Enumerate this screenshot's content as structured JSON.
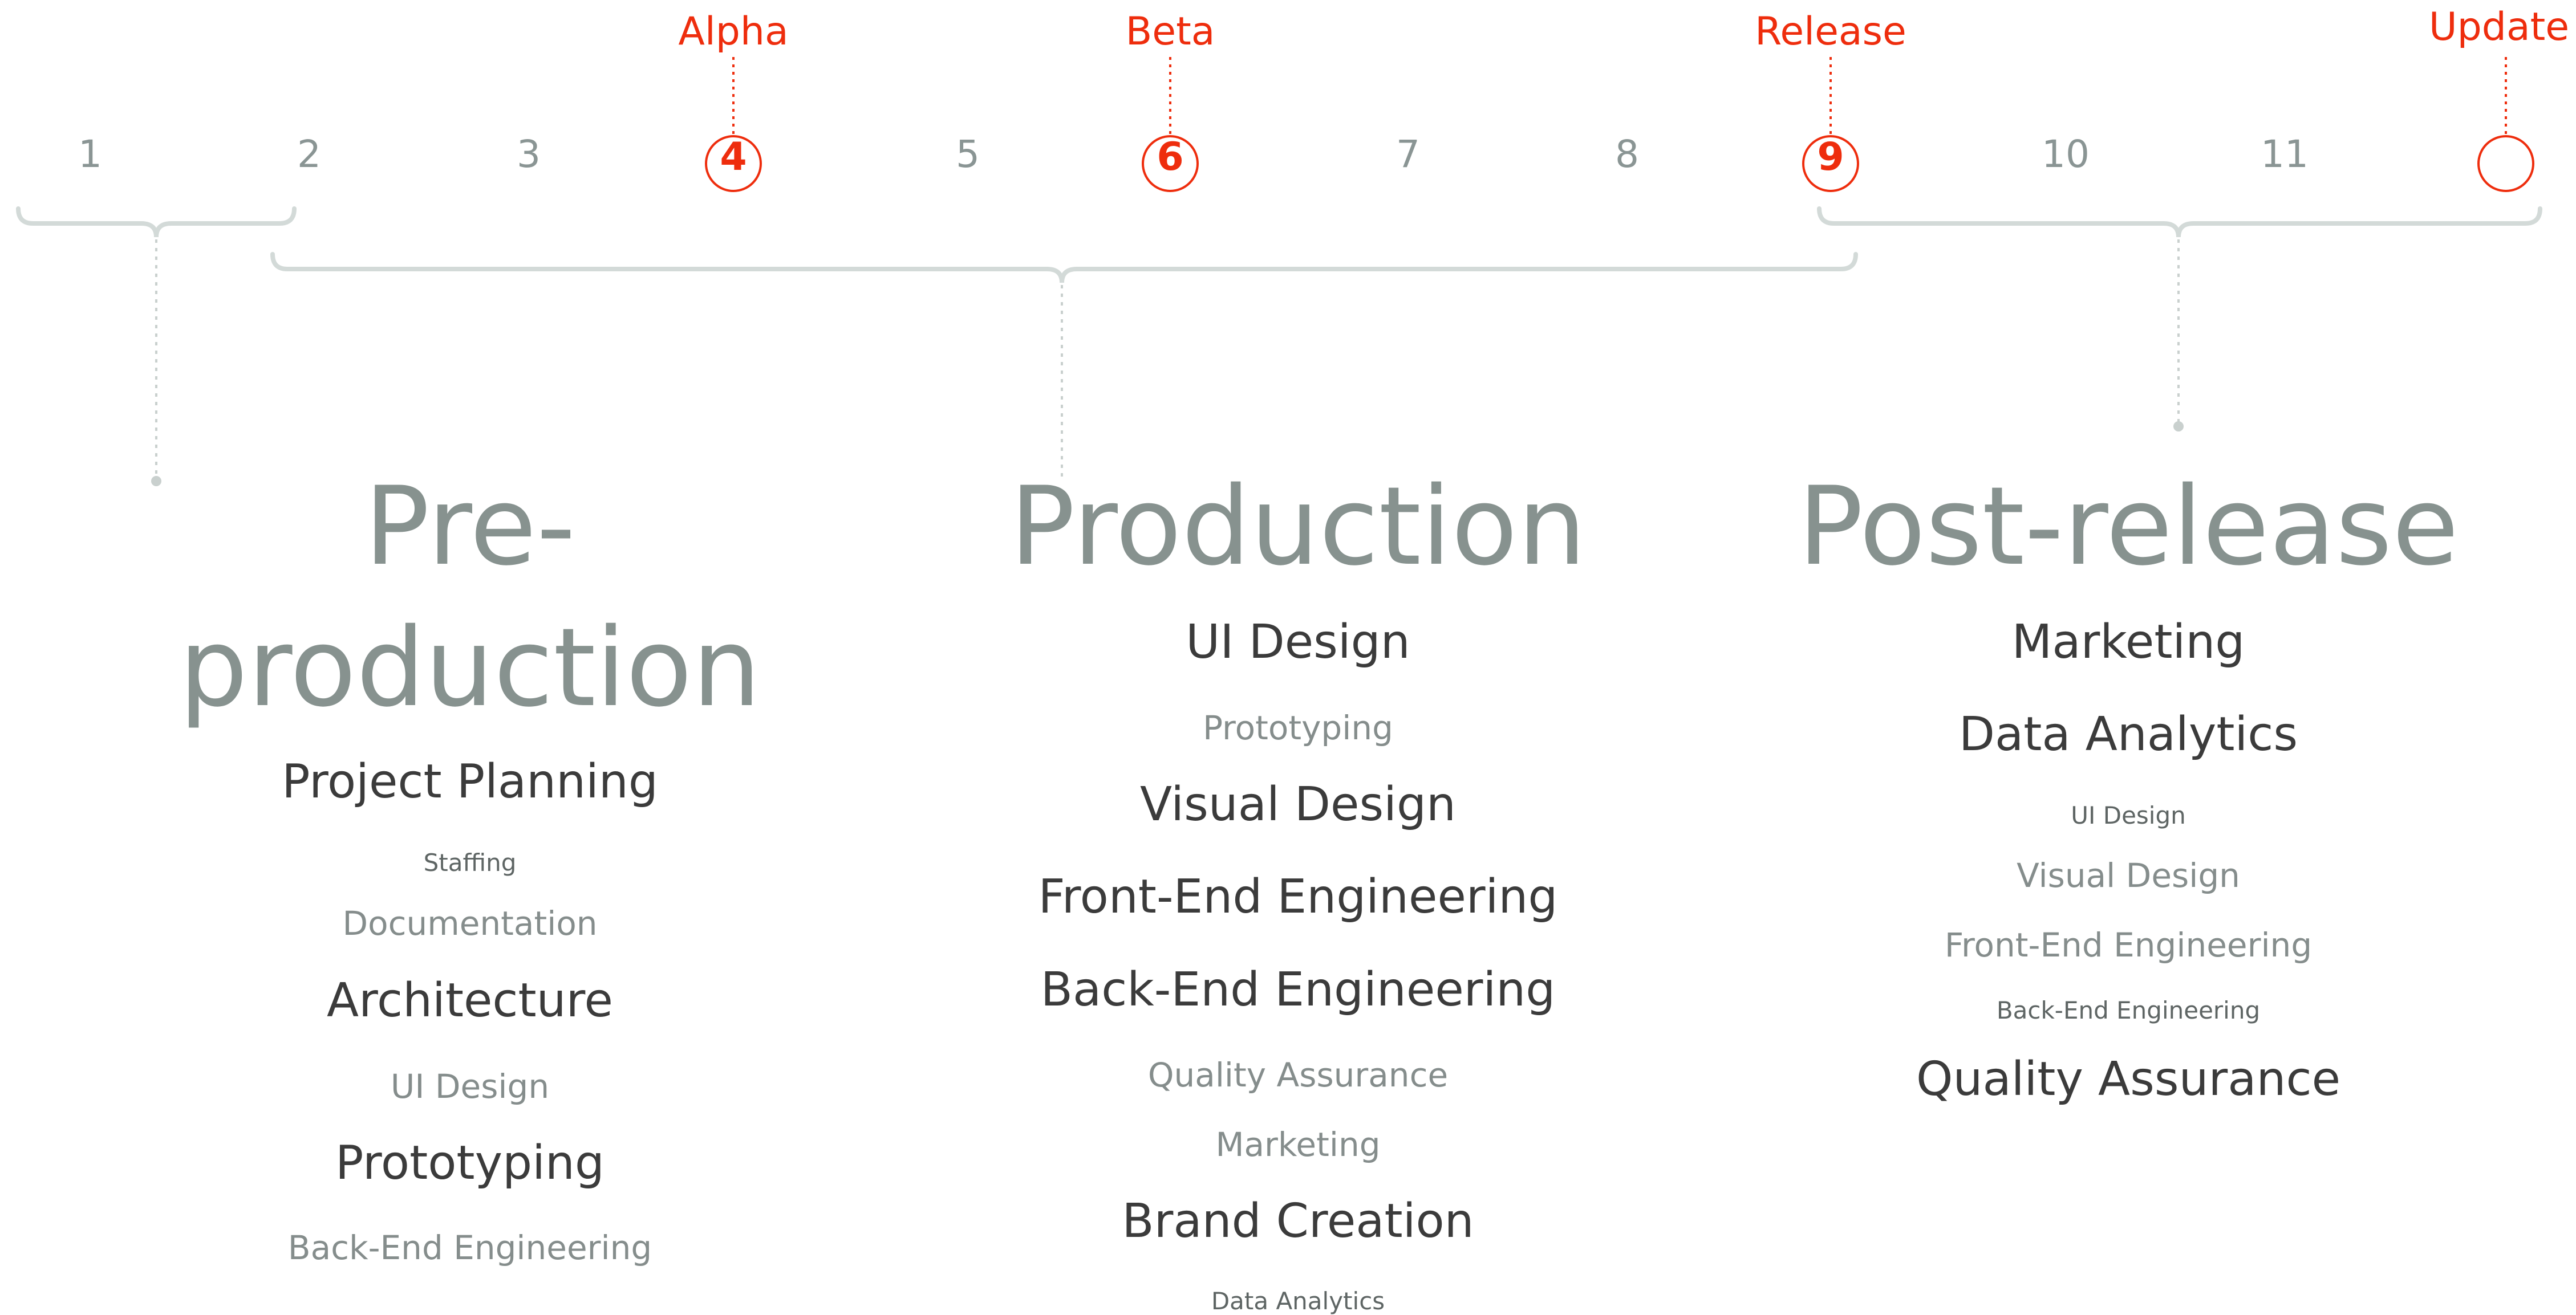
{
  "timeline": {
    "numbers": [
      "1",
      "2",
      "3",
      "4",
      "5",
      "6",
      "7",
      "8",
      "9",
      "10",
      "11",
      ""
    ],
    "milestones": [
      {
        "label": "Alpha",
        "index": 3
      },
      {
        "label": "Beta",
        "index": 5
      },
      {
        "label": "Release",
        "index": 8
      },
      {
        "label": "Update",
        "index": 11
      }
    ],
    "accent_color": "#ee2d0d",
    "bracket_color": "#d3dad8"
  },
  "phases": [
    {
      "title": "Pre-\nproduction",
      "items": [
        {
          "text": "Project Planning",
          "size": "large"
        },
        {
          "text": "Staffing",
          "size": "small"
        },
        {
          "text": "Documentation",
          "size": "medium"
        },
        {
          "text": "Architecture",
          "size": "large"
        },
        {
          "text": "UI Design",
          "size": "medium"
        },
        {
          "text": "Prototyping",
          "size": "large"
        },
        {
          "text": "Back-End Engineering",
          "size": "medium"
        }
      ]
    },
    {
      "title": "Production",
      "items": [
        {
          "text": "UI Design",
          "size": "large"
        },
        {
          "text": "Prototyping",
          "size": "medium"
        },
        {
          "text": "Visual Design",
          "size": "large"
        },
        {
          "text": "Front-End Engineering",
          "size": "large"
        },
        {
          "text": "Back-End Engineering",
          "size": "large"
        },
        {
          "text": "Quality Assurance",
          "size": "medium"
        },
        {
          "text": "Marketing",
          "size": "medium"
        },
        {
          "text": "Brand Creation",
          "size": "large"
        },
        {
          "text": "Data Analytics",
          "size": "small"
        }
      ]
    },
    {
      "title": "Post-release",
      "items": [
        {
          "text": "Marketing",
          "size": "large"
        },
        {
          "text": "Data Analytics",
          "size": "large"
        },
        {
          "text": "UI Design",
          "size": "small"
        },
        {
          "text": "Visual Design",
          "size": "medium"
        },
        {
          "text": "Front-End Engineering",
          "size": "medium"
        },
        {
          "text": "Back-End Engineering",
          "size": "small"
        },
        {
          "text": "Quality Assurance",
          "size": "large"
        }
      ]
    }
  ]
}
